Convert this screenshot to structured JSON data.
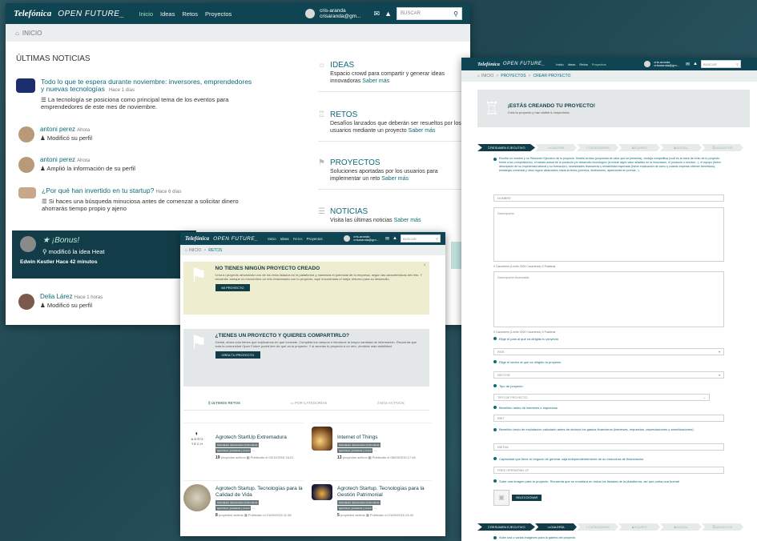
{
  "header": {
    "brand": "Telefónica",
    "open_future": "OPEN FUTURE_",
    "nav": [
      "Inicio",
      "Ideas",
      "Retos",
      "Proyectos"
    ],
    "user_name": "cris-aranda",
    "user_email": "crisaranda@gm...",
    "search_placeholder": "BUSCAR"
  },
  "main": {
    "breadcrumb": "INICIO",
    "news_title": "ÚLTIMAS NOTICIAS",
    "news": [
      {
        "title": "Todo lo que te espera durante noviembre: inversores, emprendedores y nuevas tecnologías",
        "time": "Hace 1 días",
        "body": "La tecnología se posiciona como principal tema de los eventos para emprendedores de este mes de noviembre."
      },
      {
        "user": "antoni perez",
        "time": "Ahora",
        "action": "Modificó su perfil"
      },
      {
        "user": "antoni perez",
        "time": "Ahora",
        "action": "Amplió la información de su perfil"
      },
      {
        "title": "¿Por qué han invertido en tu startup?",
        "time": "Hace 6 días",
        "body": "Si haces una búsqueda minuciosa antes de comenzar a solicitar dinero ahorrarás tiempo propio y ajeno"
      },
      {
        "bonus": "★ ¡Bonus!",
        "action": "modificó la idea Heat",
        "footer": "Edwin Kestler Hace 42 minutos"
      },
      {
        "user": "Delia Lárez",
        "time": "Hace 1 horas",
        "action": "Modificó su perfil"
      }
    ],
    "side": [
      {
        "title": "IDEAS",
        "text": "Espacio crowd para compartir y generar ideas innovadoras",
        "link": "Saber más"
      },
      {
        "title": "RETOS",
        "text": "Desafíos lanzados que deberán ser resueltos por los usuarios mediante un proyecto",
        "link": "Saber más"
      },
      {
        "title": "PROYECTOS",
        "text": "Soluciones aportadas por los usuarios para implementar un reto",
        "link": "Saber más"
      },
      {
        "title": "NOTICIAS",
        "text": "Visita las últimas noticias",
        "link": "Saber más"
      }
    ]
  },
  "retos": {
    "breadcrumb": [
      "INICIO",
      "RETOS"
    ],
    "box1": {
      "title": "NO TIENES NINGÚN PROYECTO CREADO",
      "text": "Crea tu proyecto afrontando uno de los retos listados en la plataforma y maximiza el potencial de tu empresa, según las características del reto. Y recuerda: aunque no encuentres un reto relacionado con tu proyecto, aquí encontrarás el mejor entorno para su desarrollo.",
      "button": "MI PROYECTO"
    },
    "box2": {
      "title": "¿TIENES UN PROYECTO Y QUIERES COMPARTIRLO?",
      "text": "Genial, ahora solo tienes que explicarnos en qué consiste. Completa los campos e introduce la mayor cantidad de información. Recuerda que toda la comunidad Open Future podrá leer de qué va tu proyecto. Y si asocias tu proyecto a un reto, ¡tendrás más visibilidad.",
      "button": "CREA TU PROYECTO"
    },
    "tabs": [
      "ÚLTIMOS RETOS",
      "POR CATEGORÍAS",
      "MÁS ACTIVOS"
    ],
    "cards": [
      {
        "title": "Agrotech StartUp Extremadura",
        "tags": [
          "actividades relacionadas (informática)",
          "agricultura, ganadería y pesca"
        ],
        "count": "19",
        "count_label": "proyectos activos",
        "date": "Publicado el 03/11/2016 18:21"
      },
      {
        "title": "Internet of Things",
        "tags": [
          "actividades relacionadas (informática)",
          "agricultura, ganadería y pesca"
        ],
        "count": "13",
        "count_label": "proyectos activos",
        "date": "Publicado el 08/03/2015 17:46"
      },
      {
        "title": "Agrotech Startup. Tecnologías para la Calidad de Vida",
        "tags": [
          "actividades relacionadas (informática)",
          "agricultura, ganadería y pesca"
        ],
        "count": "8",
        "count_label": "proyectos activos",
        "date": "Publicado el 01/09/2015 11:38"
      },
      {
        "title": "Agrotech Startup. Tecnologías para la Gestión Patrimonial",
        "tags": [
          "actividades relacionadas (informática)",
          "agricultura, ganadería y pesca"
        ],
        "count": "5",
        "count_label": "proyectos activos",
        "date": "Publicado el 01/09/2015 13:40"
      }
    ],
    "logo_text": "A G R O\nT E C H"
  },
  "create": {
    "breadcrumb": [
      "INICIO",
      "PROYECTOS",
      "CREAR PROYECTO"
    ],
    "banner_title": "¡ESTÁS CREANDO TU PROYECTO!",
    "banner_sub": "Crea tu proyecto y haz visible tu trayectoria.",
    "steps": [
      "RESUMEN EJECUTIVO",
      "GALERÍA",
      "CATEGORÍAS",
      "EQUIPO",
      "SOCIAL",
      "ADJUNTOS"
    ],
    "intro": "Escribe un nombre y un Resumen Ejecutivo de tu proyecto. Detalla la idea (propuesta de valor que se presenta), ventaja competitiva (cuál es la clave de éxito de tu proyecto frente a tus competidores), el estado actual de tu producto y/o desarrollo tecnológico (si existe algún valor añadido en la innovación, el producto o servicio...), el equipo (breve descripción de su experiencia laboral y su formación), necesidades financieras y rentabilidad esperada (breve explicación de cómo y cuándo esperas obtener beneficios), estrategia comercial y otros logros alcanzados hasta la fecha (premios, distinciones, apariciones en prensa...).",
    "name_placeholder": "NOMBRE",
    "desc_placeholder": "Descripción",
    "counter": "0 Caracteres (Límite 3000 Caracteres) 0 Palabras",
    "desc2_placeholder": "Descripción Avanzada",
    "fields": [
      {
        "label": "Elige el país al que va dirigido tu proyecto",
        "value": "PAÍS"
      },
      {
        "label": "Elige el sector al que va dirigido tu proyecto",
        "value": "SECTOR"
      },
      {
        "label": "Tipo de proyecto",
        "value": "TIPO DE PROYECTO"
      },
      {
        "label": "Beneficio antes de intereses e impuestos",
        "value": "EBIT"
      },
      {
        "label": "Beneficio bruto de explotación calculado antes de deducir los gastos financieros (intereses, impuestos, depreciaciones y amortizaciones).",
        "value": "EBITDA"
      },
      {
        "label": "Capacidad que tiene tu negocio de generar caja independientemente de su estructura de financiación.",
        "value": "FREE OPERATING CF"
      }
    ],
    "image_label": "Sube una imagen para tu proyecto. Recuerda que se mostrará en todos los listados de la plataforma, así que pulsa una buena!",
    "select_button": "SELECCIONAR",
    "gallery_text": "Sube una o varias imágenes para la galería del proyecto"
  }
}
